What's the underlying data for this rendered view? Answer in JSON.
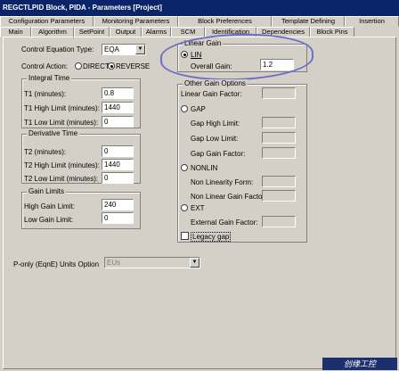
{
  "window": {
    "title": "REGCTLPID Block, PIDA - Parameters [Project]"
  },
  "tabs_top": [
    "Configuration Parameters",
    "Monitoring Parameters",
    "Block Preferences",
    "Template Defining",
    "Insertion"
  ],
  "tabs_bottom": [
    "Main",
    "Algorithm",
    "SetPoint",
    "Output",
    "Alarms",
    "SCM",
    "Identification",
    "Dependencies",
    "Block Pins"
  ],
  "control_equation": {
    "label": "Control Equation Type:",
    "value": "EQA"
  },
  "control_action": {
    "label": "Control Action:",
    "direct": "DIRECT",
    "reverse": "REVERSE",
    "selected": "REVERSE"
  },
  "integral": {
    "title": "Integral Time",
    "t1_label": "T1 (minutes):",
    "t1": "0.8",
    "t1_high_label": "T1 High Limit (minutes):",
    "t1_high": "1440",
    "t1_low_label": "T1 Low Limit (minutes):",
    "t1_low": "0"
  },
  "derivative": {
    "title": "Derivative Time",
    "t2_label": "T2 (minutes):",
    "t2": "0",
    "t2_high_label": "T2 High Limit (minutes):",
    "t2_high": "1440",
    "t2_low_label": "T2 Low Limit (minutes):",
    "t2_low": "0"
  },
  "gain_limits": {
    "title": "Gain Limits",
    "high_label": "High Gain Limit:",
    "high": "240",
    "low_label": "Low Gain Limit:",
    "low": "0"
  },
  "linear_gain": {
    "title": "Linear Gain",
    "lin_label": "LIN",
    "overall_label": "Overall Gain:",
    "overall": "1.2"
  },
  "other_gain": {
    "title": "Other Gain Options",
    "linear_factor_label": "Linear Gain Factor:",
    "gap_label": "GAP",
    "gap_high_label": "Gap High Limit:",
    "gap_low_label": "Gap Low Limit:",
    "gap_factor_label": "Gap Gain Factor:",
    "nonlin_label": "NONLIN",
    "nonlin_form_label": "Non Linearity Form:",
    "nonlin_factor_label": "Non Linear Gain Factor:",
    "ext_label": "EXT",
    "ext_factor_label": "External Gain Factor:",
    "legacy_label": "Legacy gap"
  },
  "ponly": {
    "label": "P-only (EqnE) Units Option",
    "value": "EUs"
  },
  "watermark": "创缘工控"
}
